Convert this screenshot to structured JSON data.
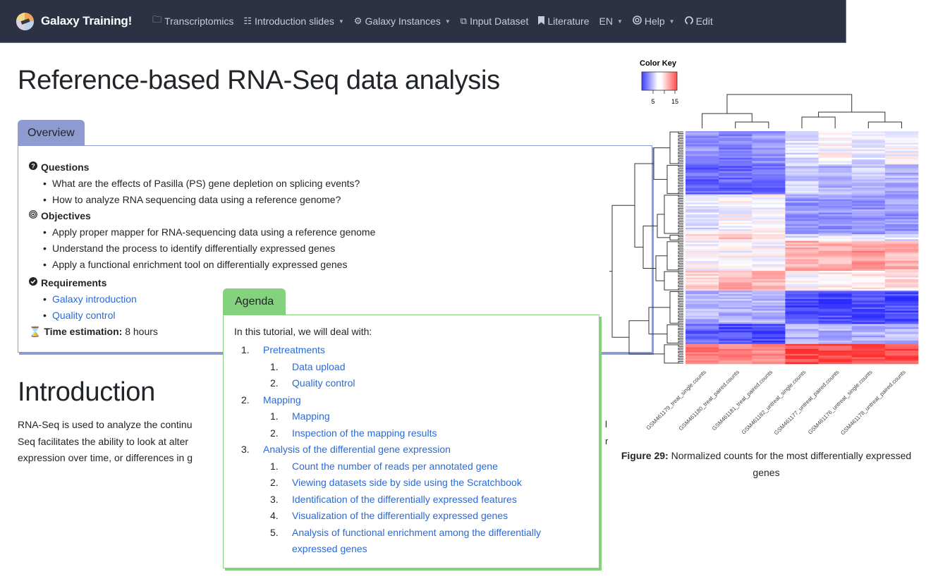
{
  "navbar": {
    "brand": "Galaxy Training!",
    "items": [
      {
        "icon": "folder-icon",
        "label": "Transcriptomics",
        "dropdown": false
      },
      {
        "icon": "slideshare-icon",
        "label": "Introduction slides",
        "dropdown": true
      },
      {
        "icon": "gear-icon",
        "label": "Galaxy Instances",
        "dropdown": true
      },
      {
        "icon": "copy-icon",
        "label": "Input Dataset",
        "dropdown": false
      },
      {
        "icon": "bookmark-icon",
        "label": "Literature",
        "dropdown": false
      },
      {
        "icon": "",
        "label": "EN",
        "dropdown": true
      },
      {
        "icon": "lifebuoy-icon",
        "label": "Help",
        "dropdown": true
      },
      {
        "icon": "github-icon",
        "label": "Edit",
        "dropdown": false
      }
    ]
  },
  "page": {
    "title": "Reference-based RNA-Seq data analysis"
  },
  "overview": {
    "tab_label": "Overview",
    "questions_label": "Questions",
    "questions": [
      "What are the effects of Pasilla (PS) gene depletion on splicing events?",
      "How to analyze RNA sequencing data using a reference genome?"
    ],
    "objectives_label": "Objectives",
    "objectives": [
      "Apply proper mapper for RNA-sequencing data using a reference genome",
      "Understand the process to identify differentially expressed genes",
      "Apply a functional enrichment tool on differentially expressed genes"
    ],
    "requirements_label": "Requirements",
    "requirements": [
      "Galaxy introduction",
      "Quality control"
    ],
    "time_label": "Time estimation:",
    "time_value": "8 hours"
  },
  "introduction": {
    "title": "Introduction",
    "lines": [
      "RNA-Seq is used to analyze the continu",
      "Seq facilitates the ability to look at alter",
      "expression over time, or differences in g"
    ],
    "right_fragments": [
      "l",
      "r"
    ]
  },
  "agenda": {
    "tab_label": "Agenda",
    "intro": "In this tutorial, we will deal with:",
    "items": [
      {
        "level": 1,
        "num": "1.",
        "label": "Pretreatments"
      },
      {
        "level": 2,
        "num": "1.",
        "label": "Data upload"
      },
      {
        "level": 2,
        "num": "2.",
        "label": "Quality control"
      },
      {
        "level": 1,
        "num": "2.",
        "label": "Mapping"
      },
      {
        "level": 2,
        "num": "1.",
        "label": "Mapping"
      },
      {
        "level": 2,
        "num": "2.",
        "label": "Inspection of the mapping results"
      },
      {
        "level": 1,
        "num": "3.",
        "label": "Analysis of the differential gene expression"
      },
      {
        "level": 2,
        "num": "1.",
        "label": "Count the number of reads per annotated gene"
      },
      {
        "level": 2,
        "num": "2.",
        "label": "Viewing datasets side by side using the Scratchbook"
      },
      {
        "level": 2,
        "num": "3.",
        "label": "Identification of the differentially expressed features"
      },
      {
        "level": 2,
        "num": "4.",
        "label": "Visualization of the differentially expressed genes"
      },
      {
        "level": 2,
        "num": "5.",
        "label": "Analysis of functional enrichment among the differentially expressed genes"
      }
    ]
  },
  "figure": {
    "caption_label": "Figure 29:",
    "caption_text": "Normalized counts for the most differentially expressed genes"
  },
  "chart_data": {
    "type": "heatmap",
    "title": "Color Key",
    "color_key": {
      "ticks": [
        "5",
        "15"
      ],
      "low_color": "#0000ff",
      "mid_color": "#ffffff",
      "high_color": "#ff0000",
      "range": [
        0,
        20
      ]
    },
    "columns": [
      "GSM461179_treat_single.counts",
      "GSM461180_treat_paired.counts",
      "GSM461181_treat_paired.counts",
      "GSM461182_untreat_single.counts",
      "GSM461177_untreat_paired.counts",
      "GSM461176_untreat_single.counts",
      "GSM461178_untreat_paired.counts"
    ],
    "row_blocks": [
      {
        "rows": 20,
        "values": [
          6,
          5,
          6,
          9,
          10,
          9,
          10
        ]
      },
      {
        "rows": 18,
        "values": [
          4,
          4,
          4,
          8,
          7,
          8,
          7
        ]
      },
      {
        "rows": 24,
        "values": [
          9,
          10,
          10,
          6,
          6,
          6,
          6
        ]
      },
      {
        "rows": 4,
        "values": [
          12,
          12,
          12,
          9,
          9,
          9,
          9
        ]
      },
      {
        "rows": 18,
        "values": [
          10,
          10,
          10,
          13,
          13,
          14,
          13
        ]
      },
      {
        "rows": 12,
        "values": [
          12,
          13,
          13,
          10,
          11,
          11,
          11
        ]
      },
      {
        "rows": 20,
        "values": [
          7,
          7,
          7,
          3,
          3,
          3,
          3
        ]
      },
      {
        "rows": 12,
        "values": [
          4,
          3,
          3,
          7,
          7,
          7,
          7
        ]
      },
      {
        "rows": 12,
        "values": [
          15,
          15,
          15,
          17,
          17,
          17,
          17
        ]
      }
    ],
    "column_dendrogram": "treat (3) vs untreat (4)",
    "row_dendrogram": true
  }
}
